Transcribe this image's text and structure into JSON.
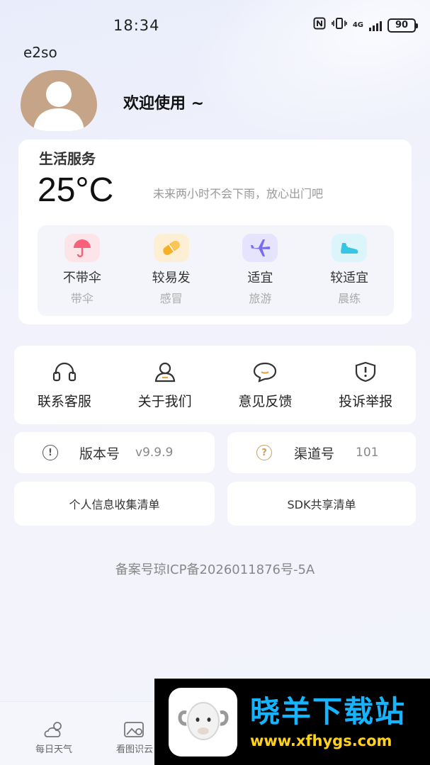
{
  "status_bar": {
    "time": "18:34",
    "network": "4G",
    "battery": "90"
  },
  "app_id": "e2so",
  "profile": {
    "welcome": "欢迎使用 ~"
  },
  "life_service": {
    "title": "生活服务",
    "temperature": "25°C",
    "note": "未来两小时不会下雨，放心出门吧",
    "items": [
      {
        "main": "不带伞",
        "sub": "带伞",
        "icon": "umbrella-icon",
        "color": "#f7627a"
      },
      {
        "main": "较易发",
        "sub": "感冒",
        "icon": "pill-icon",
        "color": "#f5b025"
      },
      {
        "main": "适宜",
        "sub": "旅游",
        "icon": "airplane-icon",
        "color": "#7a6cf2"
      },
      {
        "main": "较适宜",
        "sub": "晨练",
        "icon": "sneaker-icon",
        "color": "#35c6e3"
      }
    ]
  },
  "links": [
    {
      "label": "联系客服",
      "icon": "headset-icon"
    },
    {
      "label": "关于我们",
      "icon": "user-icon"
    },
    {
      "label": "意见反馈",
      "icon": "chat-bubble-icon"
    },
    {
      "label": "投诉举报",
      "icon": "shield-alert-icon"
    }
  ],
  "version": {
    "label": "版本号",
    "value": "v9.9.9"
  },
  "channel": {
    "label": "渠道号",
    "value": "101"
  },
  "lists": {
    "personal_info": "个人信息收集清单",
    "sdk_share": "SDK共享清单"
  },
  "icp": "备案号琼ICP备2026011876号-5A",
  "bottom_nav": [
    {
      "label": "每日天气",
      "icon": "cloud-sun-icon"
    },
    {
      "label": "看图识云",
      "icon": "image-search-icon"
    }
  ],
  "watermark": {
    "title": "晓羊下载站",
    "url": "www.xfhygs.com"
  }
}
